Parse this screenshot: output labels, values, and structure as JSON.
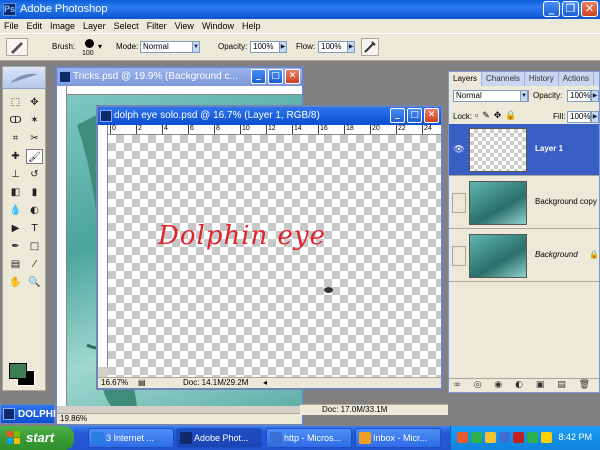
{
  "app": {
    "title": "Adobe Photoshop",
    "logo_glyph": "Ps",
    "window_buttons": {
      "minimize": "_",
      "restore": "❐",
      "close": "✕"
    }
  },
  "menu": [
    "File",
    "Edit",
    "Image",
    "Layer",
    "Select",
    "Filter",
    "View",
    "Window",
    "Help"
  ],
  "options_bar": {
    "brush_label": "Brush:",
    "brush_size": "100",
    "mode_label": "Mode:",
    "mode_value": "Normal",
    "opacity_label": "Opacity:",
    "opacity_value": "100%",
    "flow_label": "Flow:",
    "flow_value": "100%"
  },
  "toolbox": {
    "tools": [
      "marquee-tool",
      "move-tool",
      "lasso-tool",
      "magic-wand-tool",
      "crop-tool",
      "slice-tool",
      "healing-brush-tool",
      "brush-tool",
      "clone-stamp-tool",
      "history-brush-tool",
      "eraser-tool",
      "gradient-tool",
      "blur-tool",
      "dodge-tool",
      "path-select-tool",
      "type-tool",
      "pen-tool",
      "shape-tool",
      "notes-tool",
      "eyedropper-tool",
      "hand-tool",
      "zoom-tool"
    ],
    "tool_glyphs": [
      "⬚",
      "✥",
      "ↀ",
      "✶",
      "⌗",
      "✂",
      "✚",
      "🖌",
      "⊥",
      "↺",
      "◧",
      "▮",
      "💧",
      "◐",
      "▶",
      "T",
      "✒",
      "□",
      "▤",
      "⁄",
      "✋",
      "🔍"
    ],
    "selected_tool": "brush-tool",
    "foreground_color": "#3d7d56",
    "background_color": "#000000"
  },
  "documents": {
    "back": {
      "title": "Tricks.psd @ 19.9% (Background c...",
      "zoom": "19.86%"
    },
    "front": {
      "title": "dolph eye solo.psd @ 16.7% (Layer 1, RGB/8)",
      "zoom": "16.67%",
      "doc_info": "Doc: 14.1M/29.2M",
      "canvas_text": "Dolphin eye",
      "canvas_text_color": "#e0242c",
      "ruler_ticks": [
        "0",
        "2",
        "4",
        "6",
        "8",
        "10",
        "12",
        "14",
        "16",
        "18",
        "20",
        "22",
        "24"
      ]
    },
    "third_status": "Doc: 17.0M/33.1M"
  },
  "layers_palette": {
    "tabs": [
      "Layers",
      "Channels",
      "History",
      "Actions"
    ],
    "blend_mode": "Normal",
    "opacity_label": "Opacity:",
    "opacity_value": "100%",
    "lock_label": "Lock:",
    "fill_label": "Fill:",
    "fill_value": "100%",
    "layers": [
      {
        "name": "Layer 1",
        "selected": true,
        "visible": true
      },
      {
        "name": "Background copy",
        "selected": false,
        "visible": false
      },
      {
        "name": "Background",
        "selected": false,
        "visible": false,
        "locked": true
      }
    ],
    "bottom_icons": "∞ ◎ ◉ ◐ ▣ ▤ 🗑"
  },
  "minimized_window": {
    "title": "DOLPHI"
  },
  "taskbar": {
    "start_label": "start",
    "buttons": [
      {
        "label": "3 Internet ...",
        "active": false,
        "icon_color": "#2a7ce0"
      },
      {
        "label": "Adobe Phot...",
        "active": true,
        "icon_color": "#0e2a6a"
      },
      {
        "label": "http - Micros...",
        "active": false,
        "icon_color": "#3a6fd6"
      },
      {
        "label": "Inbox - Micr...",
        "active": false,
        "icon_color": "#f0a020"
      }
    ],
    "tray_icon_colors": [
      "#e85b2a",
      "#2bb34a",
      "#f4c430",
      "#3a6fd6",
      "#c02020",
      "#2bb34a",
      "#ffd200"
    ],
    "clock": "8:42 PM"
  }
}
